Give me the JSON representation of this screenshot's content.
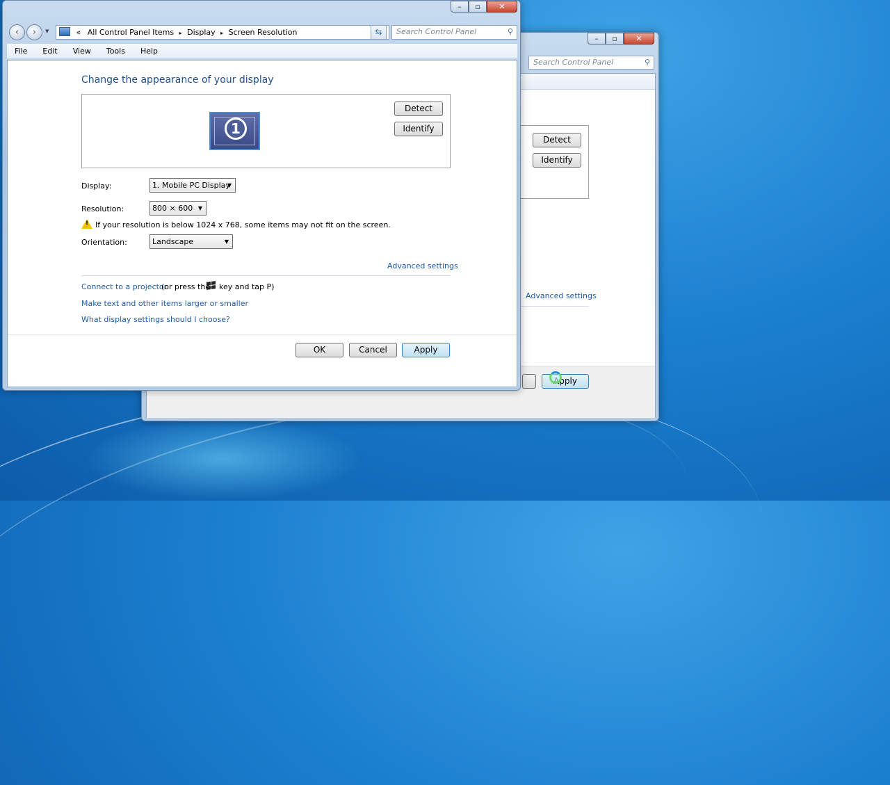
{
  "back_window": {
    "search_placeholder": "Search Control Panel",
    "detect_label": "Detect",
    "identify_label": "Identify",
    "advanced_settings": "Advanced settings",
    "apply_label": "Apply"
  },
  "main_window": {
    "breadcrumb": {
      "prefix": "«",
      "items": [
        "All Control Panel Items",
        "Display",
        "Screen Resolution"
      ],
      "separator": "▸"
    },
    "search_placeholder": "Search Control Panel",
    "menu": [
      "File",
      "Edit",
      "View",
      "Tools",
      "Help"
    ],
    "heading": "Change the appearance of your display",
    "monitor_number": "1",
    "detect_label": "Detect",
    "identify_label": "Identify",
    "display_label": "Display:",
    "display_value": "1. Mobile PC Display",
    "resolution_label": "Resolution:",
    "resolution_value": "800 × 600",
    "warning_text": "If your resolution is below 1024 x 768, some items may not fit on the screen.",
    "orientation_label": "Orientation:",
    "orientation_value": "Landscape",
    "advanced_settings": "Advanced settings",
    "projector_link": "Connect to a projector",
    "projector_suffix_1": "(or press the",
    "projector_suffix_2": "key and tap P)",
    "text_size_link": "Make text and other items larger or smaller",
    "which_settings_link": "What display settings should I choose?",
    "ok_label": "OK",
    "cancel_label": "Cancel",
    "apply_label": "Apply"
  },
  "colors": {
    "link": "#1e5ba8",
    "heading": "#1e4f8f",
    "desktop": "#1b7fd0"
  }
}
